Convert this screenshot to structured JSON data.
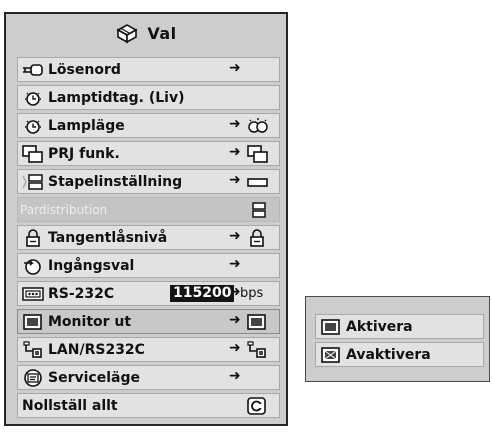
{
  "menu": {
    "title": "Val",
    "title_icon": "options-box-icon",
    "items": [
      {
        "label": "Lösenord",
        "icon": "key-icon",
        "arrow": "➜"
      },
      {
        "label": "Lamptidtag. (Liv)",
        "icon": "lamp-timer-icon"
      },
      {
        "label": "Lampläge",
        "icon": "lamp-timer-icon",
        "arrow": "➜",
        "right_icon": "lamp-mode-icon"
      },
      {
        "label": "PRJ funk.",
        "icon": "projector-function-icon",
        "arrow": "➜",
        "right_icon": "projector-function-icon"
      },
      {
        "label": "Stapelinställning",
        "icon": "stack-setting-icon",
        "arrow": "➜",
        "right_icon": "flat-rectangle-icon"
      },
      {
        "label": "Pardistribution",
        "icon": "",
        "right_icon": "stack-setting-icon",
        "disabled": true
      },
      {
        "label": "Tangentlåsnivå",
        "icon": "padlock-icon",
        "arrow": "➜",
        "right_icon": "padlock-icon"
      },
      {
        "label": "Ingångsval",
        "icon": "input-select-icon",
        "arrow": "➜"
      },
      {
        "label": "RS-232C",
        "icon": "rs232c-port-icon",
        "arrow": "➜",
        "value": "115200",
        "unit": "bps"
      },
      {
        "label": "Monitor ut",
        "icon": "monitor-out-icon",
        "arrow": "➜",
        "right_icon": "monitor-out-icon",
        "selected": true
      },
      {
        "label": "LAN/RS232C",
        "icon": "lan-icon",
        "arrow": "➜",
        "right_icon": "lan-icon"
      },
      {
        "label": "Serviceläge",
        "icon": "service-mode-icon",
        "arrow": "➜"
      },
      {
        "label": "Nollställ allt",
        "right_icon": "reset-icon"
      }
    ]
  },
  "submenu": {
    "items": [
      {
        "label": "Aktivera",
        "icon": "monitor-out-icon"
      },
      {
        "label": "Avaktivera",
        "icon": "monitor-out-disabled-icon"
      }
    ]
  },
  "colors": {
    "panel": "#cdcdcd",
    "row": "#e2e2e2",
    "selected_row": "#c8c8c8",
    "value_highlight": "#141414"
  }
}
